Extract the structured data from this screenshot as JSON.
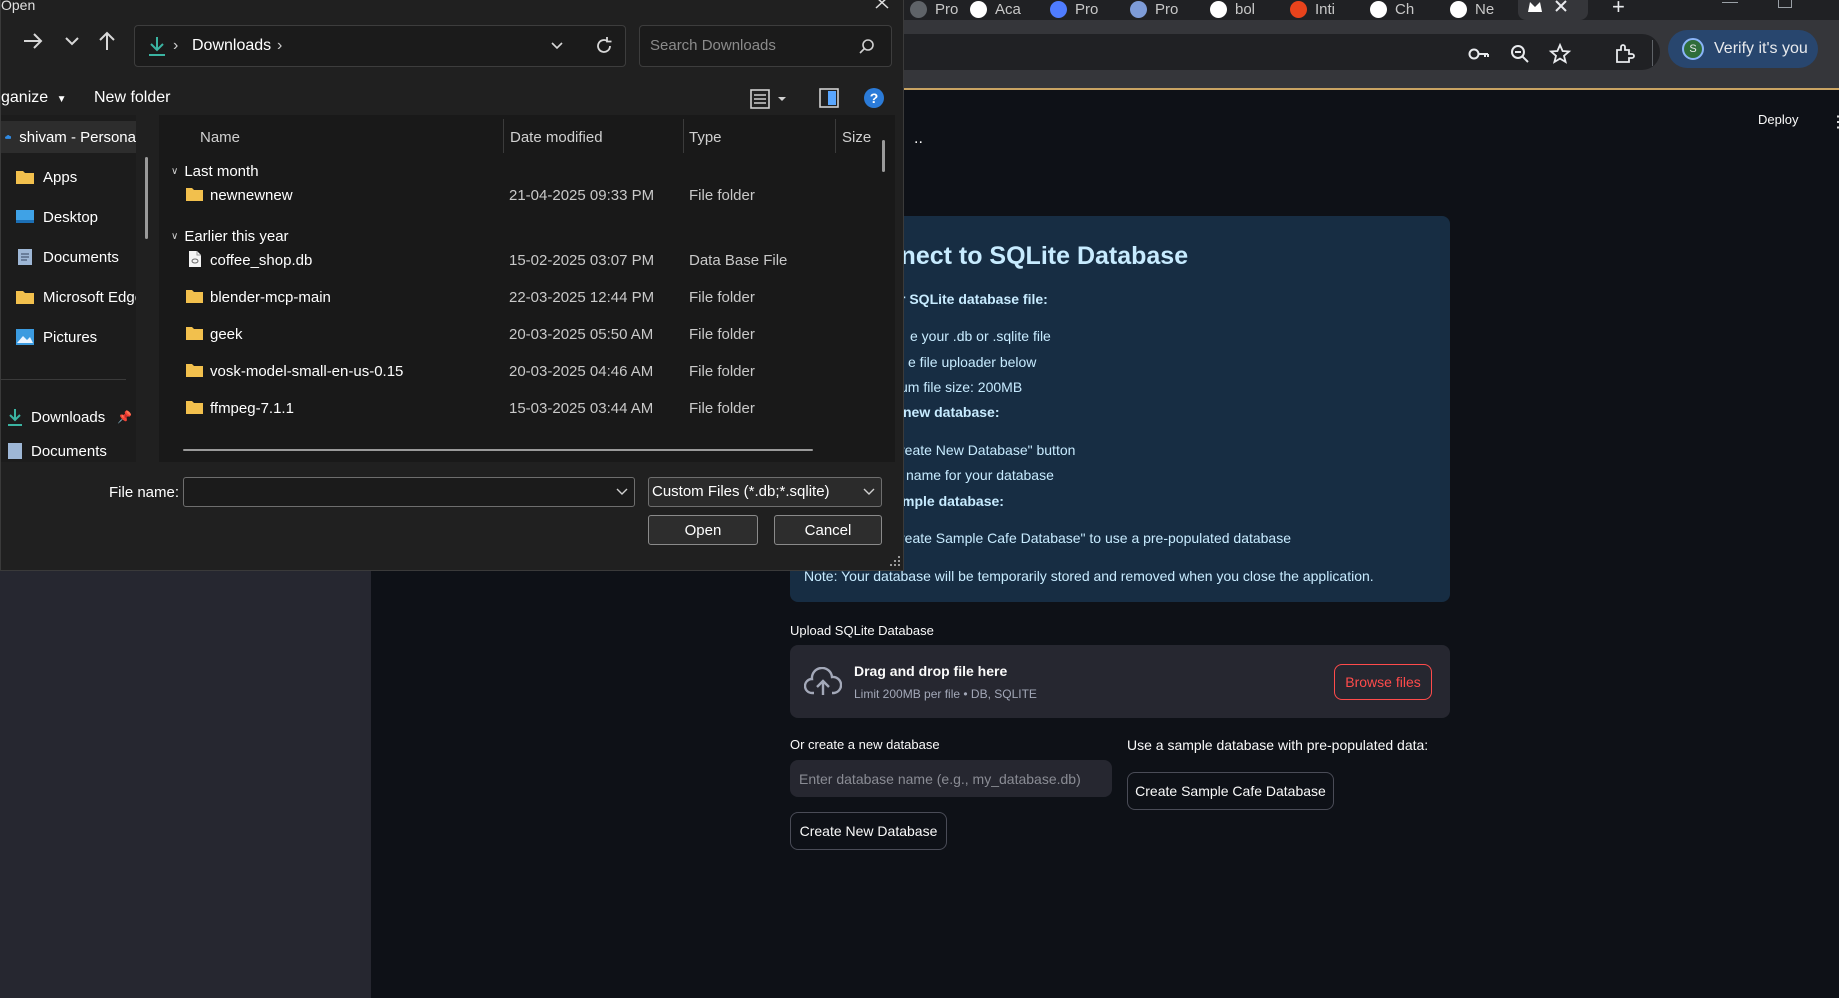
{
  "browser": {
    "tabs": [
      {
        "label": "Pro",
        "color": "#5f6368"
      },
      {
        "label": "Aca",
        "color": "#ffffff"
      },
      {
        "label": "Pro",
        "color": "#4f7cff"
      },
      {
        "label": "Pro",
        "color": "#7e9cd8"
      },
      {
        "label": "bol",
        "color": "#ffffff"
      },
      {
        "label": "Inti",
        "color": "#e8431c"
      },
      {
        "label": "Ch",
        "color": "#ffffff"
      },
      {
        "label": "Ne",
        "color": "#ffffff"
      }
    ],
    "new_tab_symbol": "+",
    "profile_button": "Verify it's you",
    "profile_initial": "S"
  },
  "app": {
    "deploy_label": "Deploy",
    "menu_glyph": "⋮",
    "stray_text": "..",
    "info": {
      "title": "onnect to SQLite Database",
      "lines": [
        "r SQLite database file:",
        "e your .db or .sqlite file",
        "e file uploader below",
        "um file size: 200MB",
        "new database:",
        "reate New Database\" button",
        "name for your database",
        "mple database:",
        "reate Sample Cafe Database\" to use a pre-populated database",
        "Note: Your database will be temporarily stored and removed when you close the application."
      ]
    },
    "upload": {
      "label": "Upload SQLite Database",
      "drag_text": "Drag and drop file here",
      "limit_text": "Limit 200MB per file • DB, SQLITE",
      "browse_label": "Browse files"
    },
    "create": {
      "label": "Or create a new database",
      "placeholder": "Enter database name (e.g., my_database.db)",
      "button": "Create New Database"
    },
    "sample": {
      "label": "Use a sample database with pre-populated data:",
      "button": "Create Sample Cafe Database"
    }
  },
  "dialog": {
    "title": "Open",
    "breadcrumb": [
      "Downloads"
    ],
    "search_placeholder": "Search Downloads",
    "organize_label": "ganize",
    "new_folder_label": "New folder",
    "nav_items": [
      {
        "label": "shivam - Persona",
        "icon": "onedrive-cloud-icon"
      },
      {
        "label": "Apps",
        "icon": "folder-icon"
      },
      {
        "label": "Desktop",
        "icon": "desktop-icon"
      },
      {
        "label": "Documents",
        "icon": "documents-icon"
      },
      {
        "label": "Microsoft Edge",
        "icon": "folder-icon"
      },
      {
        "label": "Pictures",
        "icon": "pictures-icon"
      },
      {
        "label": "Downloads",
        "icon": "download-icon"
      },
      {
        "label": "Documents",
        "icon": "documents-icon"
      }
    ],
    "columns": [
      "Name",
      "Date modified",
      "Type",
      "Size"
    ],
    "groups": [
      {
        "label": "Last month",
        "files": [
          {
            "name": "newnewnew",
            "date": "21-04-2025 09:33 PM",
            "type": "File folder",
            "kind": "folder"
          }
        ]
      },
      {
        "label": "Earlier this year",
        "files": [
          {
            "name": "coffee_shop.db",
            "date": "15-02-2025 03:07 PM",
            "type": "Data Base File",
            "kind": "file"
          },
          {
            "name": "blender-mcp-main",
            "date": "22-03-2025 12:44 PM",
            "type": "File folder",
            "kind": "folder"
          },
          {
            "name": "geek",
            "date": "20-03-2025 05:50 AM",
            "type": "File folder",
            "kind": "folder"
          },
          {
            "name": "vosk-model-small-en-us-0.15",
            "date": "20-03-2025 04:46 AM",
            "type": "File folder",
            "kind": "folder"
          },
          {
            "name": "ffmpeg-7.1.1",
            "date": "15-03-2025 03:44 AM",
            "type": "File folder",
            "kind": "folder"
          }
        ]
      }
    ],
    "file_name_label": "File name:",
    "file_name_value": "",
    "filter_value": "Custom Files (*.db;*.sqlite)",
    "open_button": "Open",
    "cancel_button": "Cancel"
  }
}
